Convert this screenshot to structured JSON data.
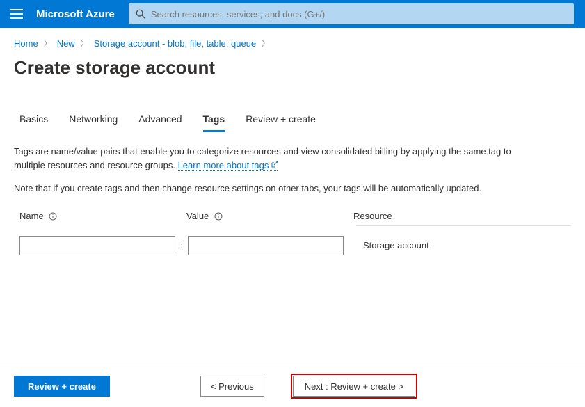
{
  "header": {
    "brand": "Microsoft Azure",
    "search_placeholder": "Search resources, services, and docs (G+/)"
  },
  "breadcrumb": {
    "items": [
      "Home",
      "New",
      "Storage account - blob, file, table, queue"
    ]
  },
  "page": {
    "title": "Create storage account"
  },
  "tabs": {
    "items": [
      "Basics",
      "Networking",
      "Advanced",
      "Tags",
      "Review + create"
    ],
    "active": "Tags"
  },
  "content": {
    "para1": "Tags are name/value pairs that enable you to categorize resources and view consolidated billing by applying the same tag to multiple resources and resource groups. ",
    "learn_more": "Learn more about tags",
    "para2": "Note that if you create tags and then change resource settings on other tabs, your tags will be automatically updated."
  },
  "tag_table": {
    "headers": {
      "name": "Name",
      "value": "Value",
      "resource": "Resource"
    },
    "row": {
      "name_value": "",
      "value_value": "",
      "resource_text": "Storage account"
    }
  },
  "footer": {
    "review_create": "Review + create",
    "previous": "< Previous",
    "next": "Next : Review + create >"
  }
}
